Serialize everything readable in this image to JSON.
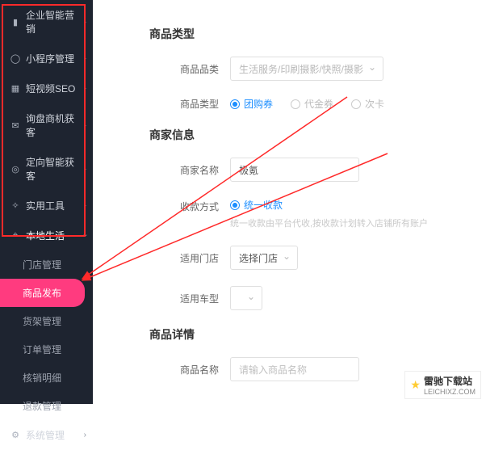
{
  "sidebar": {
    "items": [
      {
        "icon": "bar",
        "label": "企业智能营销"
      },
      {
        "icon": "ring",
        "label": "小程序管理"
      },
      {
        "icon": "grid",
        "label": "短视频SEO"
      },
      {
        "icon": "msg",
        "label": "询盘商机获客"
      },
      {
        "icon": "target",
        "label": "定向智能获客"
      },
      {
        "icon": "tool",
        "label": "实用工具"
      },
      {
        "icon": "pin",
        "label": "本地生活",
        "expanded": true
      },
      {
        "icon": "gear",
        "label": "系统管理"
      }
    ],
    "sub": [
      {
        "label": "门店管理"
      },
      {
        "label": "商品发布",
        "active": true
      },
      {
        "label": "货架管理"
      },
      {
        "label": "订单管理"
      },
      {
        "label": "核销明细"
      },
      {
        "label": "退款管理"
      }
    ]
  },
  "sections": {
    "product_type": "商品类型",
    "merchant_info": "商家信息",
    "product_detail": "商品详情"
  },
  "form": {
    "category": {
      "label": "商品品类",
      "value": "生活服务/印刷摄影/快照/摄影"
    },
    "type": {
      "label": "商品类型",
      "options": [
        "团购券",
        "代金券",
        "次卡"
      ],
      "selected": 0
    },
    "merchant_name": {
      "label": "商家名称",
      "value": "极氪"
    },
    "collect": {
      "label": "收款方式",
      "options": [
        "统一收款"
      ],
      "selected": 0,
      "hint": "统一收款由平台代收,按收款计划转入店铺所有账户"
    },
    "store": {
      "label": "适用门店",
      "button": "选择门店"
    },
    "car": {
      "label": "适用车型"
    },
    "name": {
      "label": "商品名称",
      "placeholder": "请输入商品名称"
    }
  },
  "watermark": {
    "title": "雷驰下载站",
    "sub": "LEICHIXZ.COM"
  }
}
